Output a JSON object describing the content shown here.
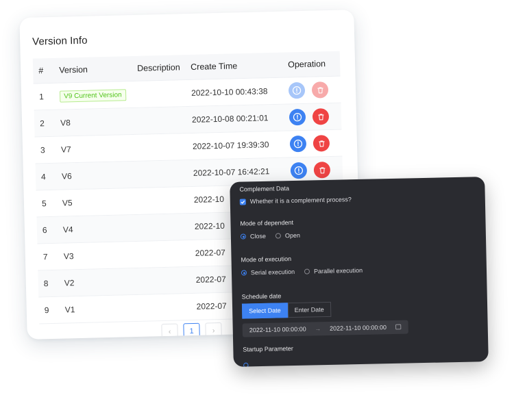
{
  "version_info": {
    "title": "Version Info",
    "columns": [
      "#",
      "Version",
      "Description",
      "Create Time",
      "Operation"
    ],
    "rows": [
      {
        "num": "1",
        "version": "V9 Current Version",
        "is_current": true,
        "description": "",
        "create_time": "2022-10-10 00:43:38",
        "ops_disabled": true
      },
      {
        "num": "2",
        "version": "V8",
        "description": "",
        "create_time": "2022-10-08 00:21:01"
      },
      {
        "num": "3",
        "version": "V7",
        "description": "",
        "create_time": "2022-10-07 19:39:30"
      },
      {
        "num": "4",
        "version": "V6",
        "description": "",
        "create_time": "2022-10-07 16:42:21"
      },
      {
        "num": "5",
        "version": "V5",
        "description": "",
        "create_time": "2022-10"
      },
      {
        "num": "6",
        "version": "V4",
        "description": "",
        "create_time": "2022-10"
      },
      {
        "num": "7",
        "version": "V3",
        "description": "",
        "create_time": "2022-07"
      },
      {
        "num": "8",
        "version": "V2",
        "description": "",
        "create_time": "2022-07"
      },
      {
        "num": "9",
        "version": "V1",
        "description": "",
        "create_time": "2022-07"
      }
    ],
    "pagination": {
      "prev": "‹",
      "current": "1",
      "next": "›"
    },
    "icons": {
      "info": "info-circle-icon",
      "delete": "trash-icon"
    },
    "colors": {
      "info": "#3d82f2",
      "delete": "#ef4444",
      "tag": "#52c41a"
    }
  },
  "complement": {
    "section_title": "Complement Data",
    "checkbox_label": "Whether it is a complement process?",
    "checkbox_checked": true,
    "dependent": {
      "label": "Mode of dependent",
      "options": [
        "Close",
        "Open"
      ],
      "selected": "Close"
    },
    "execution": {
      "label": "Mode of execution",
      "options": [
        "Serial execution",
        "Parallel execution"
      ],
      "selected": "Serial execution"
    },
    "schedule": {
      "label": "Schedule date",
      "tabs": [
        "Select Date",
        "Enter Date"
      ],
      "active_tab": "Select Date",
      "start": "2022-11-10 00:00:00",
      "arrow": "→",
      "end": "2022-11-10 00:00:00"
    },
    "startup": {
      "label": "Startup Parameter"
    }
  }
}
